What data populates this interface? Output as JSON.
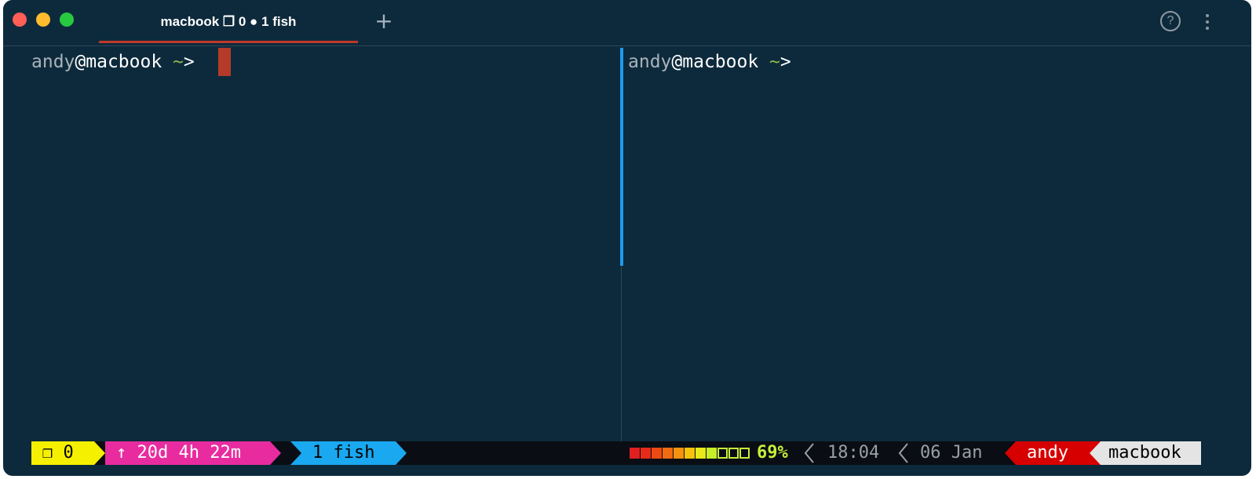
{
  "titlebar": {
    "tab_label": "macbook ❐ 0 ● 1 fish",
    "new_tab_label": "+",
    "help_label": "?"
  },
  "left_pane": {
    "prompt_user": "andy",
    "prompt_at": "@",
    "prompt_host": "macbook",
    "prompt_tilde": " ~",
    "prompt_arrow": ">"
  },
  "right_pane": {
    "prompt_user": "andy",
    "prompt_at": "@",
    "prompt_host": "macbook",
    "prompt_tilde": " ~",
    "prompt_arrow": ">"
  },
  "statusbar": {
    "session": "❐ 0",
    "uptime": "↑ 20d 4h 22m",
    "window": "1 fish",
    "battery_percent": "69%",
    "battery_level": 0.69,
    "time": "18:04",
    "date": "06 Jan",
    "user": "andy",
    "host": "macbook"
  },
  "colors": {
    "background": "#0d2a3c",
    "tab_underline": "#c0392b",
    "cursor": "#b53a29",
    "active_divider": "#1e9bea",
    "session_segment": "#f5f000",
    "uptime_segment": "#e82ca0",
    "window_segment": "#1aa8f0",
    "battery_text": "#c6f03a",
    "user_segment": "#d70000",
    "host_segment": "#e4e4e4"
  }
}
